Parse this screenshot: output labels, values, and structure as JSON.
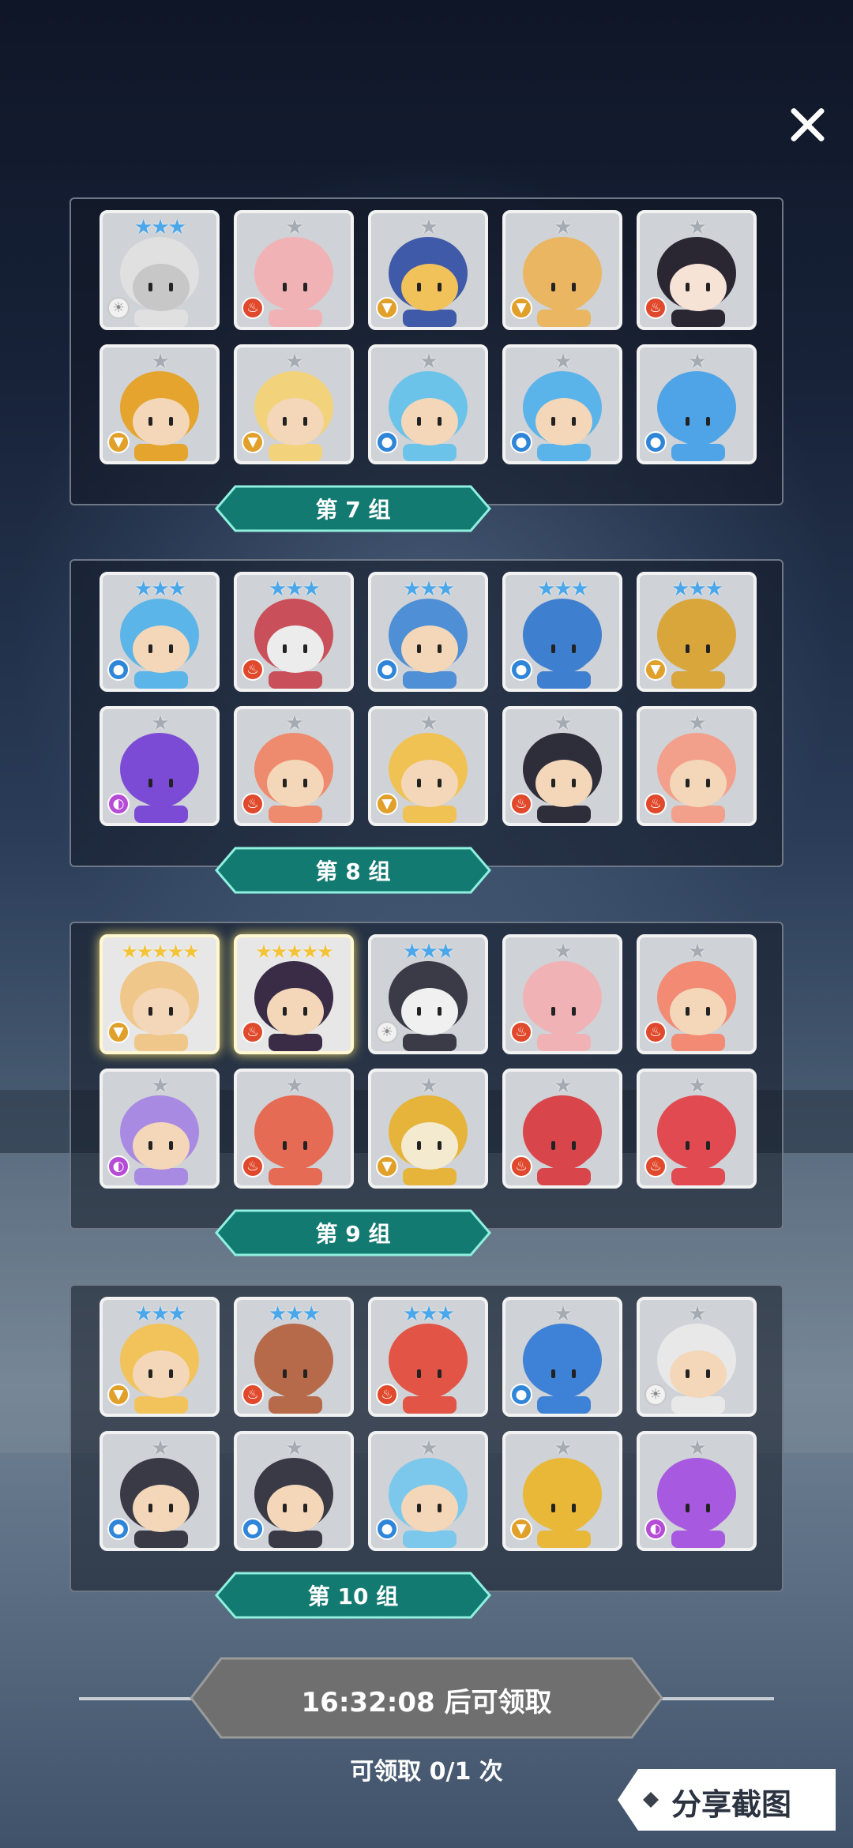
{
  "groups": [
    {
      "label": "第 7 组",
      "cards": [
        {
          "stars": 3,
          "star_color": "blue",
          "element": "light",
          "color": "#c7c7c7",
          "hair": "#e0e0e0"
        },
        {
          "stars": 1,
          "star_color": "gray",
          "element": "fire",
          "color": "#f1b2b6",
          "hair": "#f1b2b6"
        },
        {
          "stars": 1,
          "star_color": "gray",
          "element": "earth",
          "color": "#f1c15a",
          "hair": "#3f5aa8"
        },
        {
          "stars": 1,
          "star_color": "gray",
          "element": "earth",
          "color": "#ebb661",
          "hair": "#ebb661"
        },
        {
          "stars": 1,
          "star_color": "gray",
          "element": "fire",
          "color": "#f7e2d6",
          "hair": "#2a2733"
        },
        {
          "stars": 1,
          "star_color": "gray",
          "element": "earth",
          "color": "#f3d7b8",
          "hair": "#e4a42e"
        },
        {
          "stars": 1,
          "star_color": "gray",
          "element": "earth",
          "color": "#f3d7b8",
          "hair": "#f2d27a"
        },
        {
          "stars": 1,
          "star_color": "gray",
          "element": "water",
          "color": "#f3d7b8",
          "hair": "#6cc3ea"
        },
        {
          "stars": 1,
          "star_color": "gray",
          "element": "water",
          "color": "#f3d7b8",
          "hair": "#5ab4ea"
        },
        {
          "stars": 1,
          "star_color": "gray",
          "element": "water",
          "color": "#4fa4e8",
          "hair": "#4fa4e8"
        }
      ]
    },
    {
      "label": "第 8 组",
      "cards": [
        {
          "stars": 3,
          "star_color": "blue",
          "element": "water",
          "color": "#f3d7b8",
          "hair": "#5cb5e8"
        },
        {
          "stars": 3,
          "star_color": "blue",
          "element": "fire",
          "color": "#ececec",
          "hair": "#c9505a"
        },
        {
          "stars": 3,
          "star_color": "blue",
          "element": "water",
          "color": "#f3d7b8",
          "hair": "#4e8fd6"
        },
        {
          "stars": 3,
          "star_color": "blue",
          "element": "water",
          "color": "#3f7fcf",
          "hair": "#3f7fcf"
        },
        {
          "stars": 3,
          "star_color": "blue",
          "element": "earth",
          "color": "#d9a63c",
          "hair": "#d9a63c"
        },
        {
          "stars": 1,
          "star_color": "gray",
          "element": "dark",
          "color": "#7b4bd6",
          "hair": "#7b4bd6"
        },
        {
          "stars": 1,
          "star_color": "gray",
          "element": "fire",
          "color": "#f3d7b8",
          "hair": "#ee8a6e"
        },
        {
          "stars": 1,
          "star_color": "gray",
          "element": "earth",
          "color": "#f3d7b8",
          "hair": "#f0c253"
        },
        {
          "stars": 1,
          "star_color": "gray",
          "element": "fire",
          "color": "#f3d7b8",
          "hair": "#2e2e3a"
        },
        {
          "stars": 1,
          "star_color": "gray",
          "element": "fire",
          "color": "#f3d7b8",
          "hair": "#f2a08c"
        }
      ]
    },
    {
      "label": "第 9 组",
      "cards": [
        {
          "stars": 5,
          "star_color": "gold",
          "element": "earth",
          "color": "#f3d7b8",
          "hair": "#f0c78a"
        },
        {
          "stars": 5,
          "star_color": "gold",
          "element": "fire",
          "color": "#f3d7b8",
          "hair": "#3a2c46"
        },
        {
          "stars": 3,
          "star_color": "blue",
          "element": "light",
          "color": "#f0f0f0",
          "hair": "#3b3b48"
        },
        {
          "stars": 1,
          "star_color": "gray",
          "element": "fire",
          "color": "#f1b2b6",
          "hair": "#f1b2b6"
        },
        {
          "stars": 1,
          "star_color": "gray",
          "element": "fire",
          "color": "#f3d7b8",
          "hair": "#f28a74"
        },
        {
          "stars": 1,
          "star_color": "gray",
          "element": "dark",
          "color": "#f3d7b8",
          "hair": "#a98ae3"
        },
        {
          "stars": 1,
          "star_color": "gray",
          "element": "fire",
          "color": "#e66b55",
          "hair": "#e66b55"
        },
        {
          "stars": 1,
          "star_color": "gray",
          "element": "earth",
          "color": "#f3ead0",
          "hair": "#e6b43a"
        },
        {
          "stars": 1,
          "star_color": "gray",
          "element": "fire",
          "color": "#d8464b",
          "hair": "#d8464b"
        },
        {
          "stars": 1,
          "star_color": "gray",
          "element": "fire",
          "color": "#e24a52",
          "hair": "#e24a52"
        }
      ]
    },
    {
      "label": "第 10 组",
      "cards": [
        {
          "stars": 3,
          "star_color": "blue",
          "element": "earth",
          "color": "#f3d7b8",
          "hair": "#f2c35a"
        },
        {
          "stars": 3,
          "star_color": "blue",
          "element": "fire",
          "color": "#b76a4a",
          "hair": "#b76a4a"
        },
        {
          "stars": 3,
          "star_color": "blue",
          "element": "fire",
          "color": "#e25445",
          "hair": "#e25445"
        },
        {
          "stars": 1,
          "star_color": "gray",
          "element": "water",
          "color": "#3d82d6",
          "hair": "#3d82d6"
        },
        {
          "stars": 1,
          "star_color": "gray",
          "element": "light",
          "color": "#f3d7b8",
          "hair": "#e8e8e8"
        },
        {
          "stars": 1,
          "star_color": "gray",
          "element": "water",
          "color": "#f3d7b8",
          "hair": "#3a3a46"
        },
        {
          "stars": 1,
          "star_color": "gray",
          "element": "water",
          "color": "#f3d7b8",
          "hair": "#3a3a46"
        },
        {
          "stars": 1,
          "star_color": "gray",
          "element": "water",
          "color": "#f3d7b8",
          "hair": "#7cc8ec"
        },
        {
          "stars": 1,
          "star_color": "gray",
          "element": "earth",
          "color": "#e9b839",
          "hair": "#e9b839"
        },
        {
          "stars": 1,
          "star_color": "gray",
          "element": "dark",
          "color": "#a75ae0",
          "hair": "#a75ae0"
        }
      ]
    }
  ],
  "timer": {
    "text": "16:32:08 后可领取"
  },
  "claim": {
    "text": "可领取 0/1 次"
  },
  "share": {
    "label": "分享截图"
  },
  "colors": {
    "banner": "#137a72",
    "banner_edge": "#8ff0df",
    "timer_btn": "#6e6e6e"
  },
  "icons": {
    "close": "close-icon",
    "share": "diamond-icon"
  }
}
